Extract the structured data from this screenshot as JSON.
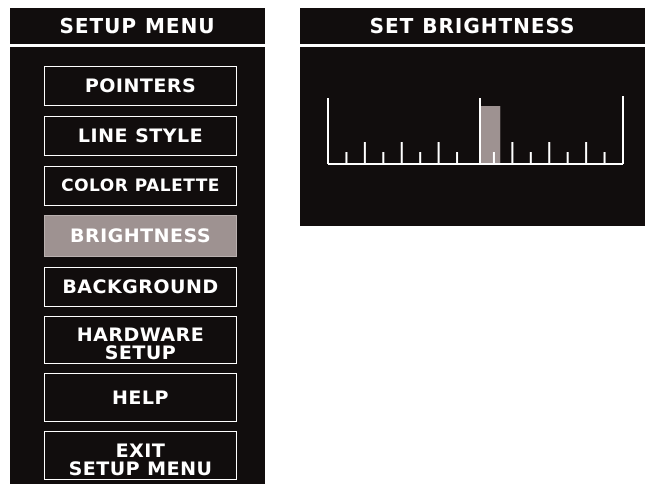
{
  "setup_menu": {
    "title": "SETUP MENU",
    "items": [
      {
        "label": "POINTERS",
        "selected": false
      },
      {
        "label": "LINE STYLE",
        "selected": false
      },
      {
        "label": "COLOR PALETTE",
        "selected": false
      },
      {
        "label": "BRIGHTNESS",
        "selected": true
      },
      {
        "label": "BACKGROUND",
        "selected": false
      },
      {
        "label": "HARDWARE\nSETUP",
        "selected": false
      },
      {
        "label": "HELP",
        "selected": false
      },
      {
        "label": "EXIT\nSETUP MENU",
        "selected": false
      }
    ]
  },
  "brightness": {
    "title": "SET BRIGHTNESS",
    "level_fraction": 0.55,
    "colors": {
      "panel_bg": "#110d0d",
      "foreground": "#ffffff",
      "selection": "#9e9291"
    }
  }
}
